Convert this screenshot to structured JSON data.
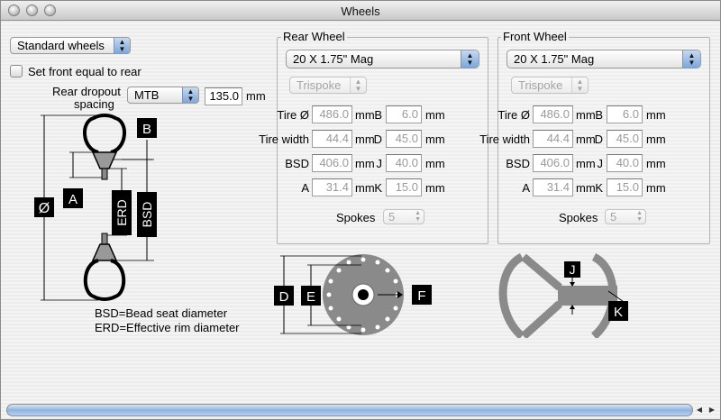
{
  "window": {
    "title": "Wheels"
  },
  "left": {
    "wheel_set_select": "Standard wheels",
    "front_equal_rear_label": "Set front equal to rear",
    "front_equal_rear_checked": false,
    "rear_dropout_label_line1": "Rear dropout",
    "rear_dropout_label_line2": "spacing",
    "rear_dropout_select": "MTB",
    "rear_dropout_value": "135.0",
    "rear_dropout_unit": "mm",
    "legend_bsd": "BSD=Bead seat diameter",
    "legend_erd": "ERD=Effective rim diameter"
  },
  "diagram_labels": {
    "diameter": "Ø",
    "A": "A",
    "B": "B",
    "ERD": "ERD",
    "BSD": "BSD",
    "D": "D",
    "E": "E",
    "F": "F",
    "J": "J",
    "K": "K"
  },
  "rear": {
    "group_title": "Rear Wheel",
    "size_select": "20 X 1.75\" Mag",
    "type_select": "Trispoke",
    "rows": [
      {
        "label": "Tire Ø",
        "value": "486.0",
        "unit": "mm",
        "label2": "B",
        "value2": "6.0",
        "unit2": "mm"
      },
      {
        "label": "Tire width",
        "value": "44.4",
        "unit": "mm",
        "label2": "D",
        "value2": "45.0",
        "unit2": "mm"
      },
      {
        "label": "BSD",
        "value": "406.0",
        "unit": "mm",
        "label2": "J",
        "value2": "40.0",
        "unit2": "mm"
      },
      {
        "label": "A",
        "value": "31.4",
        "unit": "mm",
        "label2": "K",
        "value2": "15.0",
        "unit2": "mm"
      }
    ],
    "spokes_label": "Spokes",
    "spokes_value": "5"
  },
  "front": {
    "group_title": "Front Wheel",
    "size_select": "20 X 1.75\" Mag",
    "type_select": "Trispoke",
    "rows": [
      {
        "label": "Tire Ø",
        "value": "486.0",
        "unit": "mm",
        "label2": "B",
        "value2": "6.0",
        "unit2": "mm"
      },
      {
        "label": "Tire width",
        "value": "44.4",
        "unit": "mm",
        "label2": "D",
        "value2": "45.0",
        "unit2": "mm"
      },
      {
        "label": "BSD",
        "value": "406.0",
        "unit": "mm",
        "label2": "J",
        "value2": "40.0",
        "unit2": "mm"
      },
      {
        "label": "A",
        "value": "31.4",
        "unit": "mm",
        "label2": "K",
        "value2": "15.0",
        "unit2": "mm"
      }
    ],
    "spokes_label": "Spokes",
    "spokes_value": "5"
  },
  "icons": {
    "popup_arrows": "up-down-arrows",
    "scroll_left": "scroll-left-arrow",
    "scroll_right": "scroll-right-arrow"
  }
}
